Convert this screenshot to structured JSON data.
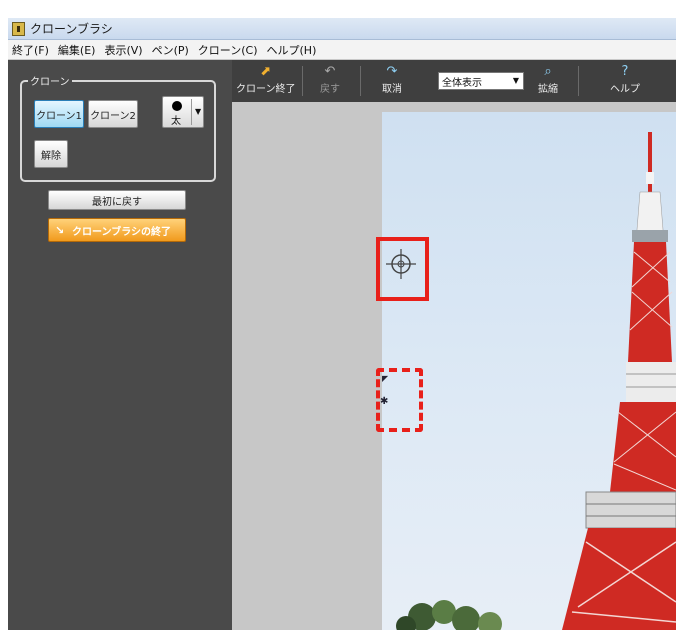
{
  "window": {
    "title": "クローンブラシ"
  },
  "menu": [
    "終了(F)",
    "編集(E)",
    "表示(V)",
    "ペン(P)",
    "クローン(C)",
    "ヘルプ(H)"
  ],
  "clone_panel": {
    "group_label": "クローン",
    "clone1_label": "クローン1",
    "clone2_label": "クローン2",
    "pen_size_label": "太",
    "release_label": "解除",
    "reset_label": "最初に戻す",
    "finish_label": "クローンブラシの終了"
  },
  "toolbar": {
    "end_clone": "クローン終了",
    "undo": "戻す",
    "cancel": "取消",
    "view_select": "全体表示",
    "zoom": "拡縮",
    "help": "ヘルプ"
  },
  "colors": {
    "marker": "#e8201a",
    "tower_red": "#cf2a23",
    "tower_white": "#f4f4f4",
    "panel": "#4a4a4a"
  }
}
